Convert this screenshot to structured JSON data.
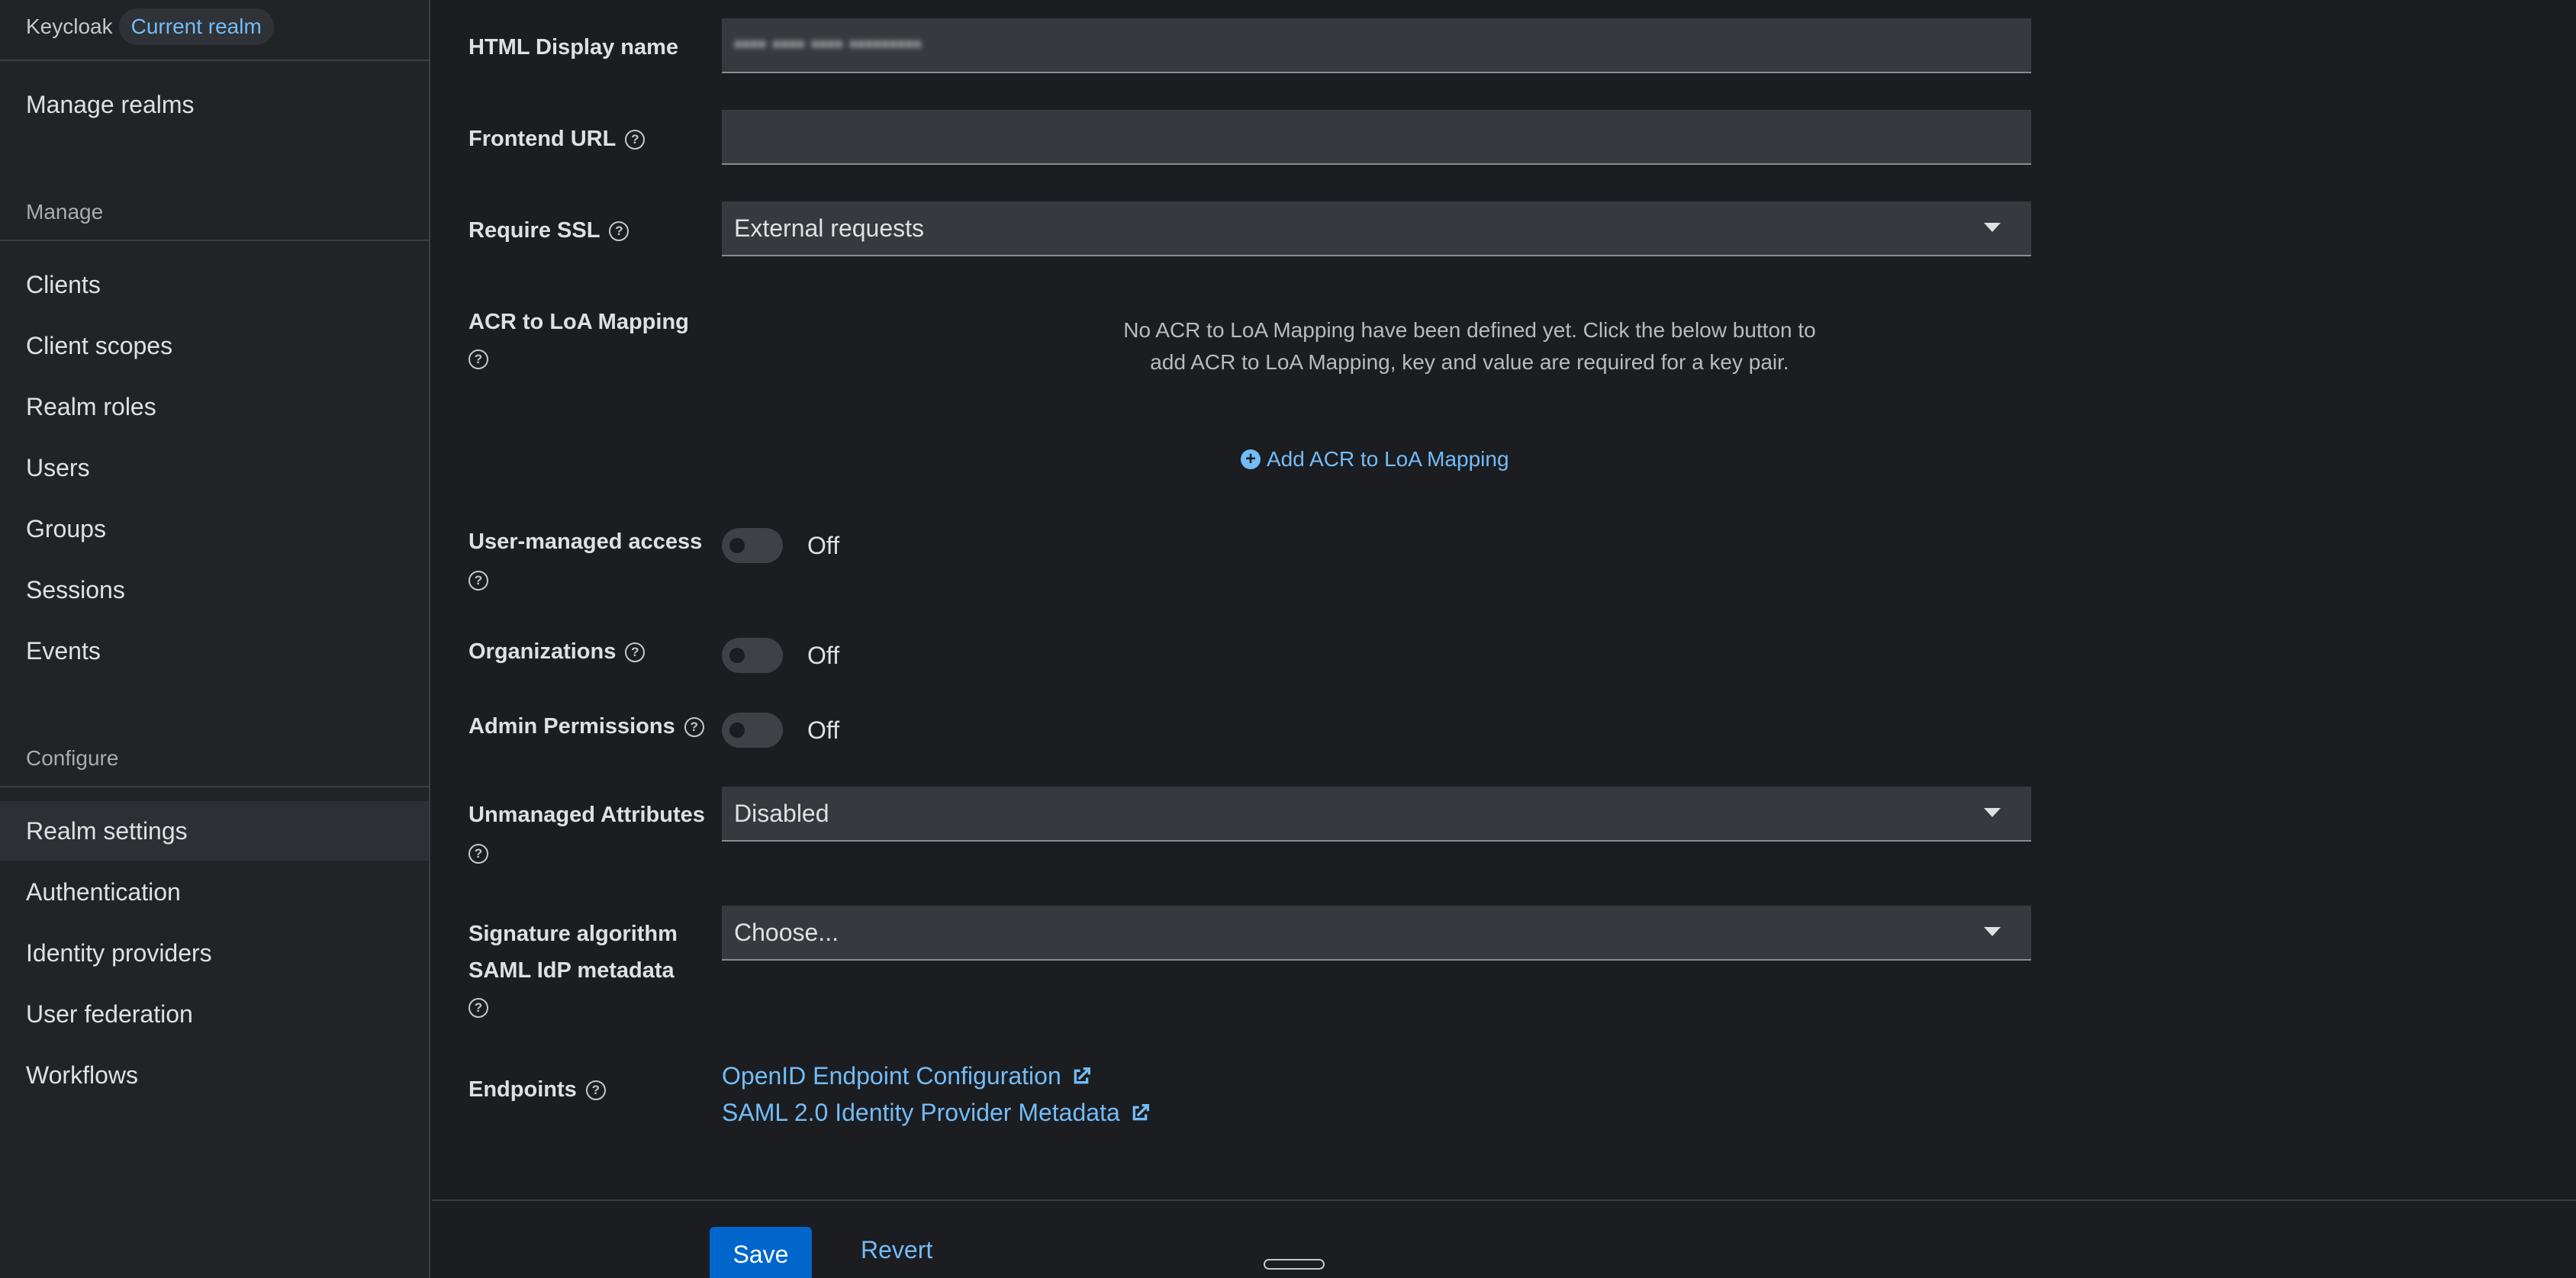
{
  "sidebar": {
    "brand": "Keycloak",
    "realm_pill": "Current realm",
    "manage_realms": "Manage realms",
    "section_manage": "Manage",
    "manage_items": [
      "Clients",
      "Client scopes",
      "Realm roles",
      "Users",
      "Groups",
      "Sessions",
      "Events"
    ],
    "section_configure": "Configure",
    "configure_items": [
      "Realm settings",
      "Authentication",
      "Identity providers",
      "User federation",
      "Workflows"
    ],
    "active_item": "Realm settings"
  },
  "form": {
    "html_display_name": {
      "label": "HTML Display name",
      "value": "•••• •••• •••• •••••••••"
    },
    "frontend_url": {
      "label": "Frontend URL",
      "value": ""
    },
    "require_ssl": {
      "label": "Require SSL",
      "value": "External requests"
    },
    "acr_loa": {
      "label": "ACR to LoA Mapping",
      "empty_text": "No ACR to LoA Mapping have been defined yet. Click the below button to add ACR to LoA Mapping, key and value are required for a key pair.",
      "add_label": "Add ACR to LoA Mapping"
    },
    "user_managed_access": {
      "label": "User-managed access",
      "state": "Off"
    },
    "organizations": {
      "label": "Organizations",
      "state": "Off"
    },
    "admin_permissions": {
      "label": "Admin Permissions",
      "state": "Off"
    },
    "unmanaged_attributes": {
      "label": "Unmanaged Attributes",
      "value": "Disabled"
    },
    "signature_algorithm": {
      "label_line1": "Signature algorithm",
      "label_line2": "SAML IdP metadata",
      "value": "Choose..."
    },
    "endpoints": {
      "label": "Endpoints",
      "openid": "OpenID Endpoint Configuration",
      "saml": "SAML 2.0 Identity Provider Metadata"
    }
  },
  "footer": {
    "save": "Save",
    "revert": "Revert"
  },
  "icons": {
    "help": "help-circle-icon",
    "plus": "plus-circle-icon",
    "external": "external-link-icon",
    "caret": "caret-down-icon"
  },
  "colors": {
    "link": "#73bcf7",
    "primary": "#0066cc"
  }
}
